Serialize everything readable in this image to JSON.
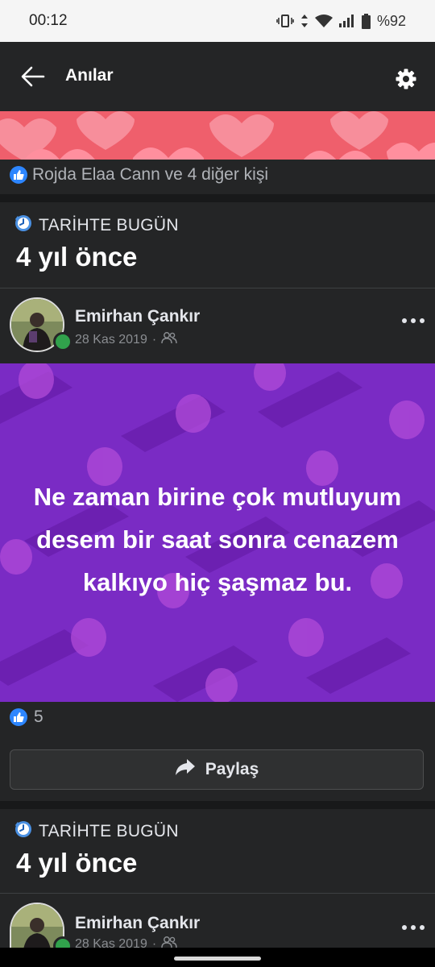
{
  "status_bar": {
    "time": "00:12",
    "battery": "%92"
  },
  "app_bar": {
    "title": "Anılar"
  },
  "top_post": {
    "reactions_text": "Rojda Elaa Cann ve 4 diğer kişi"
  },
  "memory_1": {
    "section_label": "TARİHTE BUGÜN",
    "years_ago": "4 yıl önce",
    "post": {
      "author": "Emirhan Çankır",
      "date": "28 Kas 2019",
      "text_lines": [
        "Ne zaman birine çok mutluyum",
        "desem bir saat sonra cenazem",
        "kalkıyo hiç şaşmaz bu."
      ],
      "like_count": "5",
      "share_label": "Paylaş"
    }
  },
  "memory_2": {
    "section_label": "TARİHTE BUGÜN",
    "years_ago": "4 yıl önce",
    "post": {
      "author": "Emirhan Çankır",
      "date": "28 Kas 2019"
    }
  },
  "colors": {
    "accent_blue": "#2d86ff",
    "post_background": "#7a2bc4",
    "hearts_background": "#ef5f6c",
    "online_green": "#31a24c"
  }
}
